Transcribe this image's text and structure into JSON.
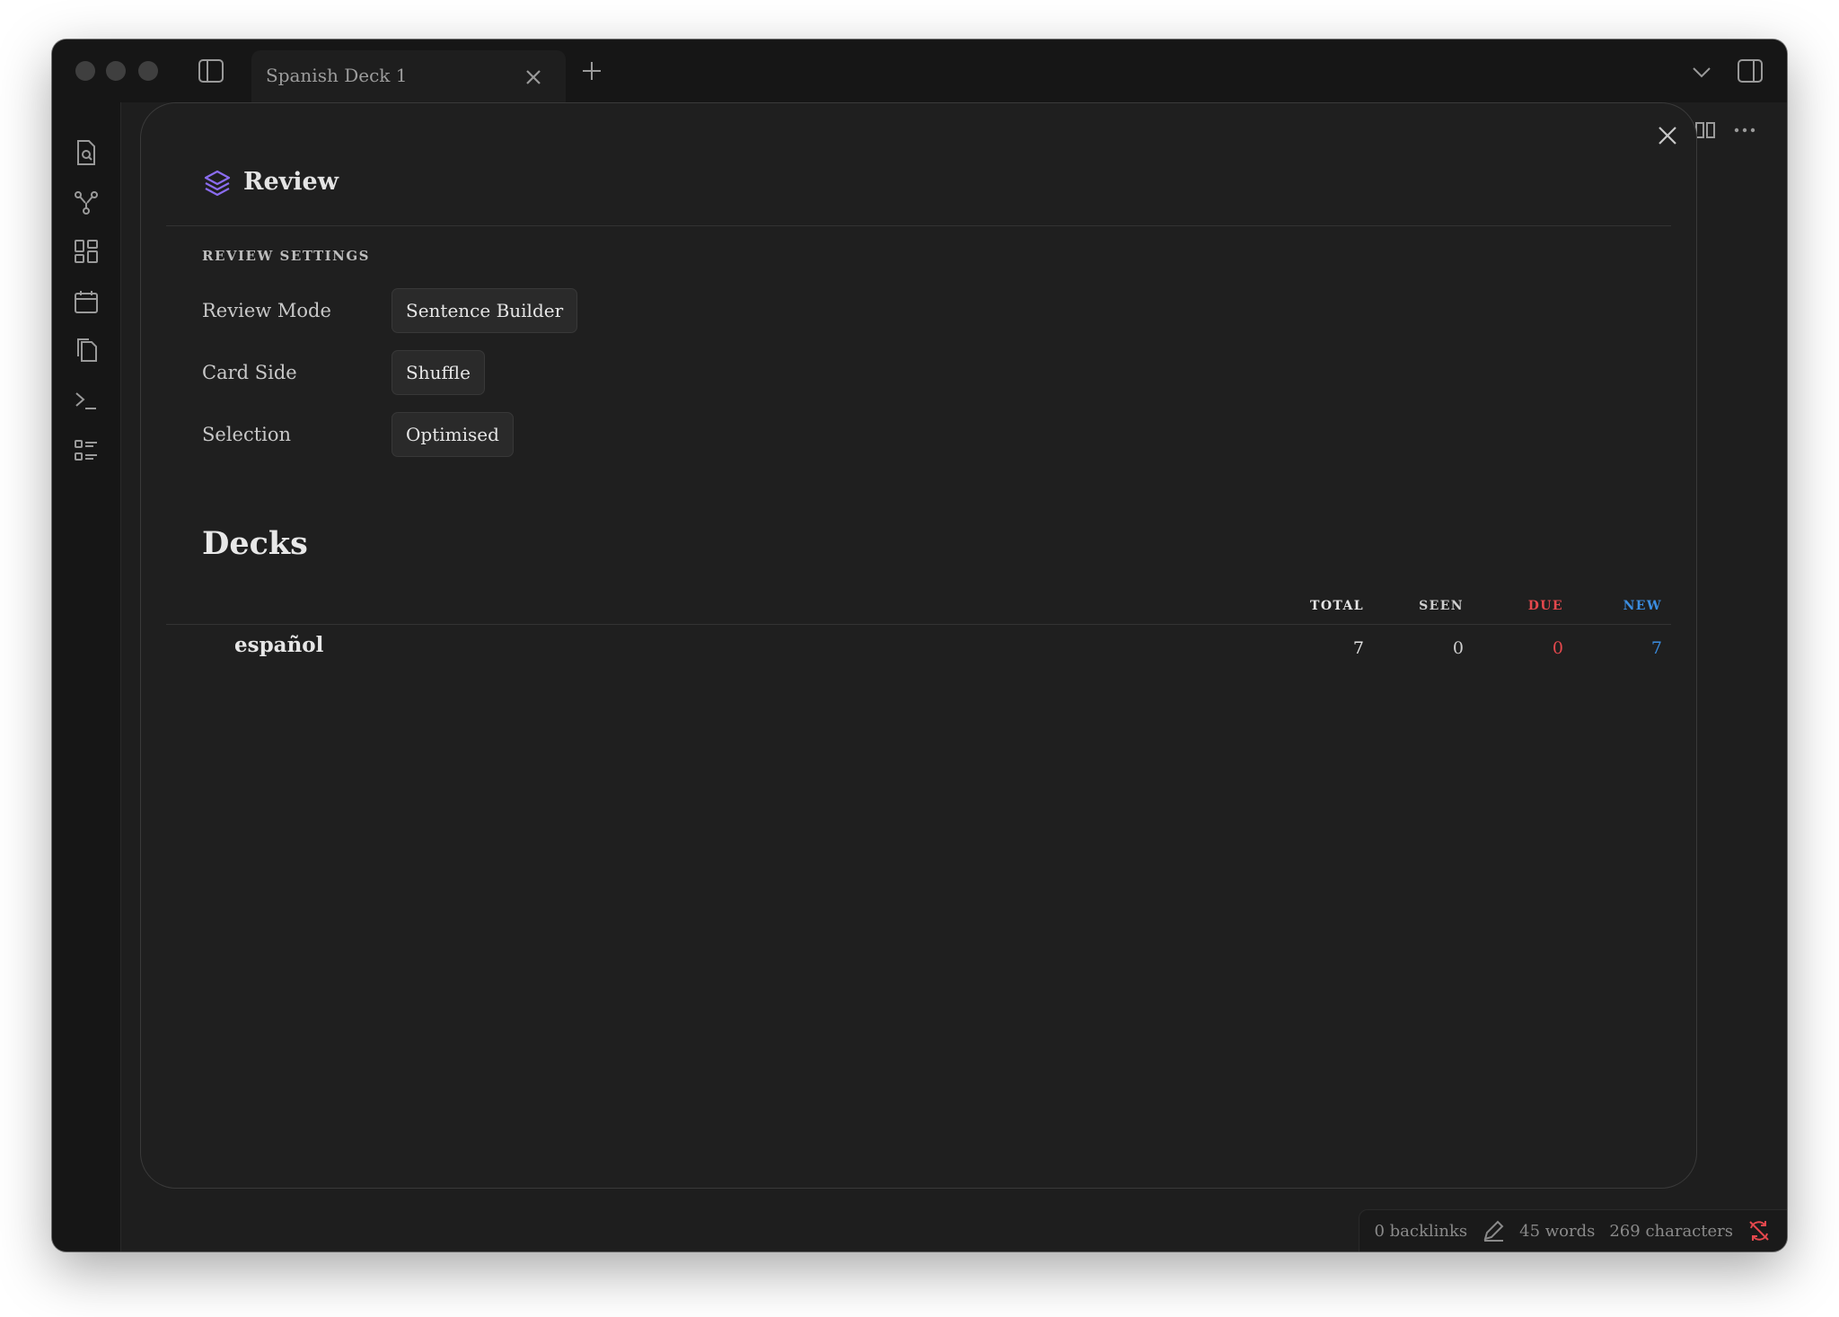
{
  "tab": {
    "title": "Spanish Deck 1"
  },
  "modal": {
    "title": "Review",
    "settings_header": "REVIEW SETTINGS",
    "settings": [
      {
        "label": "Review Mode",
        "value": "Sentence Builder"
      },
      {
        "label": "Card Side",
        "value": "Shuffle"
      },
      {
        "label": "Selection",
        "value": "Optimised"
      }
    ],
    "decks_title": "Decks",
    "columns": {
      "total": "TOTAL",
      "seen": "SEEN",
      "due": "DUE",
      "new": "NEW"
    },
    "decks": [
      {
        "name": "español",
        "total": "7",
        "seen": "0",
        "due": "0",
        "new": "7"
      }
    ]
  },
  "status": {
    "backlinks": "0 backlinks",
    "words": "45 words",
    "characters": "269 characters"
  },
  "colors": {
    "accent_purple": "#8b6cf0",
    "due_red": "#e5484d",
    "new_blue": "#3b8de0"
  },
  "icons": {
    "ribbon": [
      "search-file-icon",
      "graph-icon",
      "grid-icon",
      "calendar-icon",
      "copy-icon",
      "terminal-icon",
      "list-icon"
    ]
  }
}
